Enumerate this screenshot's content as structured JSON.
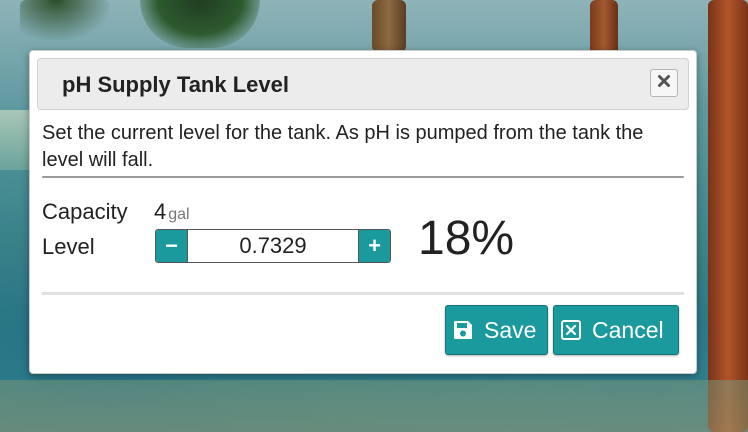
{
  "dialog": {
    "title": "pH Supply Tank Level",
    "description": "Set the current level for the tank. As pH is pumped from the tank the level will fall.",
    "close_icon": "close-icon",
    "capacity": {
      "label": "Capacity",
      "value": "4",
      "unit": "gal"
    },
    "level": {
      "label": "Level",
      "value": "0.7329",
      "decrement_label": "−",
      "increment_label": "+",
      "percent": "18%"
    },
    "buttons": {
      "save_label": "Save",
      "save_icon": "floppy-disk-icon",
      "cancel_label": "Cancel",
      "cancel_icon": "close-box-icon"
    }
  },
  "colors": {
    "accent": "#1a9a9c",
    "titlebar_bg": "#ececec",
    "text": "#222222"
  }
}
